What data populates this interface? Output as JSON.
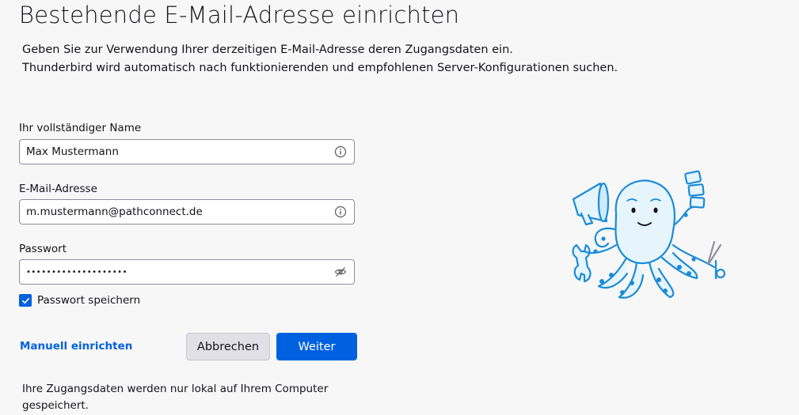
{
  "page": {
    "title": "Bestehende E-Mail-Adresse einrichten",
    "intro_line1": "Geben Sie zur Verwendung Ihrer derzeitigen E-Mail-Adresse deren Zugangsdaten ein.",
    "intro_line2": "Thunderbird wird automatisch nach funktionierenden und empfohlenen Server-Konfigurationen suchen."
  },
  "form": {
    "name_label": "Ihr vollständiger Name",
    "name_value": "Max Mustermann",
    "email_label": "E-Mail-Adresse",
    "email_value": "m.mustermann@pathconnect.de",
    "password_label": "Passwort",
    "password_value": "••••••••••••••••••••",
    "remember_label": "Passwort speichern",
    "remember_checked": true
  },
  "actions": {
    "manual_label": "Manuell einrichten",
    "cancel_label": "Abbrechen",
    "next_label": "Weiter"
  },
  "footnote": {
    "text": "Ihre Zugangsdaten werden nur lokal auf Ihrem Computer gespeichert."
  },
  "icons": {
    "name_field_icon": "info-icon",
    "email_field_icon": "info-icon",
    "password_field_icon": "eye-slash-icon",
    "checkbox_icon": "checkmark-icon",
    "illustration": "octopus-mascot"
  },
  "colors": {
    "accent": "#0061e0",
    "background": "#f7f7f7",
    "mascot_blue": "#1a8cd8",
    "mascot_fill": "#e6f4fc"
  }
}
